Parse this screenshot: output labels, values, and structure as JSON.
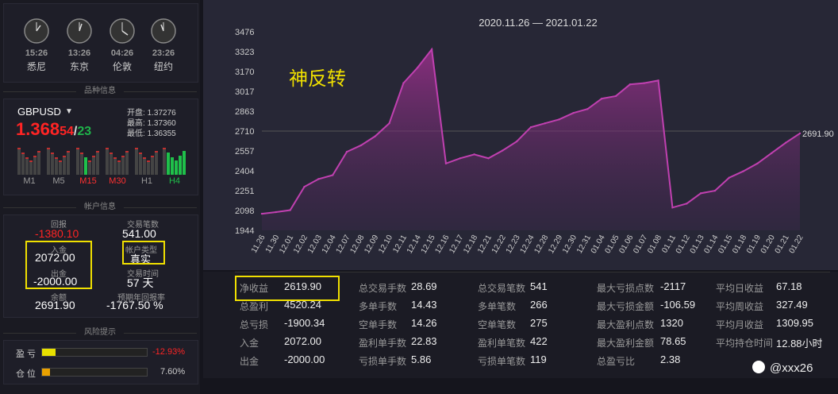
{
  "clocks": [
    {
      "time": "15:26",
      "city": "悉尼"
    },
    {
      "time": "13:26",
      "city": "东京"
    },
    {
      "time": "04:26",
      "city": "伦敦"
    },
    {
      "time": "23:26",
      "city": "纽约"
    }
  ],
  "symbol_section": "品种信息",
  "symbol": {
    "name": "GBPUSD",
    "price_main": "1.368",
    "price_big": "54",
    "price_sep": "/",
    "price_ask": "23",
    "open_label": "开盘:",
    "open": "1.37276",
    "high_label": "最高:",
    "high": "1.37360",
    "low_label": "最低:",
    "low": "1.36355"
  },
  "timeframes": [
    "M1",
    "M5",
    "M15",
    "M30",
    "H1",
    "H4"
  ],
  "account_section": "帐户信息",
  "account": {
    "return_label": "回报",
    "return": "-1380.10",
    "deposit_label": "入金",
    "deposit": "2072.00",
    "withdraw_label": "出金",
    "withdraw": "-2000.00",
    "balance_label": "余额",
    "balance": "2691.90",
    "trades_label": "交易笔数",
    "trades": "541.00",
    "type_label": "帐户类型",
    "type": "真实",
    "time_label": "交易时间",
    "time": "57 天",
    "annual_label": "预期年回报率",
    "annual": "-1767.50 %"
  },
  "risk_section": "风险提示",
  "risk": [
    {
      "label": "盈 亏",
      "value": "-12.93%",
      "level": 0.1293,
      "color": "#e8e000"
    },
    {
      "label": "仓 位",
      "value": "7.60%",
      "level": 0.076,
      "color": "#e8a000"
    }
  ],
  "chart_data": {
    "type": "area",
    "title": "2020.11.26 — 2021.01.22",
    "annotation": "神反转",
    "last_label": "2691.90",
    "ylim": [
      1944,
      3476
    ],
    "yticks": [
      "3476",
      "3323",
      "3170",
      "3017",
      "2863",
      "2710",
      "2557",
      "2404",
      "2251",
      "2098",
      "1944"
    ],
    "x": [
      "11.26",
      "11.30",
      "12.01",
      "12.02",
      "12.03",
      "12.04",
      "12.07",
      "12.08",
      "12.09",
      "12.10",
      "12.11",
      "12.14",
      "12.15",
      "12.16",
      "12.17",
      "12.18",
      "12.21",
      "12.22",
      "12.23",
      "12.24",
      "12.28",
      "12.29",
      "12.30",
      "12.31",
      "01.04",
      "01.05",
      "01.06",
      "01.07",
      "01.08",
      "01.11",
      "01.12",
      "01.13",
      "01.14",
      "01.15",
      "01.18",
      "01.19",
      "01.20",
      "01.21",
      "01.22"
    ],
    "values": [
      2072,
      2085,
      2100,
      2280,
      2340,
      2370,
      2550,
      2600,
      2670,
      2770,
      3080,
      3200,
      3340,
      2460,
      2500,
      2530,
      2500,
      2560,
      2630,
      2740,
      2770,
      2800,
      2850,
      2880,
      2960,
      2980,
      3070,
      3080,
      3100,
      2120,
      2150,
      2230,
      2250,
      2350,
      2400,
      2460,
      2540,
      2620,
      2691.9
    ]
  },
  "stats": [
    [
      {
        "label": "净收益",
        "value": "2619.90"
      },
      {
        "label": "总盈利",
        "value": "4520.24"
      },
      {
        "label": "总亏损",
        "value": "-1900.34"
      },
      {
        "label": "入金",
        "value": "2072.00"
      },
      {
        "label": "出金",
        "value": "-2000.00"
      }
    ],
    [
      {
        "label": "总交易手数",
        "value": "28.69"
      },
      {
        "label": "多单手数",
        "value": "14.43"
      },
      {
        "label": "空单手数",
        "value": "14.26"
      },
      {
        "label": "盈利单手数",
        "value": "22.83"
      },
      {
        "label": "亏损单手数",
        "value": "5.86"
      }
    ],
    [
      {
        "label": "总交易笔数",
        "value": "541"
      },
      {
        "label": "多单笔数",
        "value": "266"
      },
      {
        "label": "空单笔数",
        "value": "275"
      },
      {
        "label": "盈利单笔数",
        "value": "422"
      },
      {
        "label": "亏损单笔数",
        "value": "119"
      }
    ],
    [
      {
        "label": "最大亏损点数",
        "value": "-2117"
      },
      {
        "label": "最大亏损金额",
        "value": "-106.59"
      },
      {
        "label": "最大盈利点数",
        "value": "1320"
      },
      {
        "label": "最大盈利金额",
        "value": "78.65"
      },
      {
        "label": "总盈亏比",
        "value": "2.38"
      }
    ],
    [
      {
        "label": "平均日收益",
        "value": "67.18"
      },
      {
        "label": "平均周收益",
        "value": "327.49"
      },
      {
        "label": "平均月收益",
        "value": "1309.95"
      },
      {
        "label": "平均持仓时间",
        "value": "12.88小时"
      },
      {
        "label": "",
        "value": ""
      }
    ]
  ],
  "watermark": "@xxx26"
}
